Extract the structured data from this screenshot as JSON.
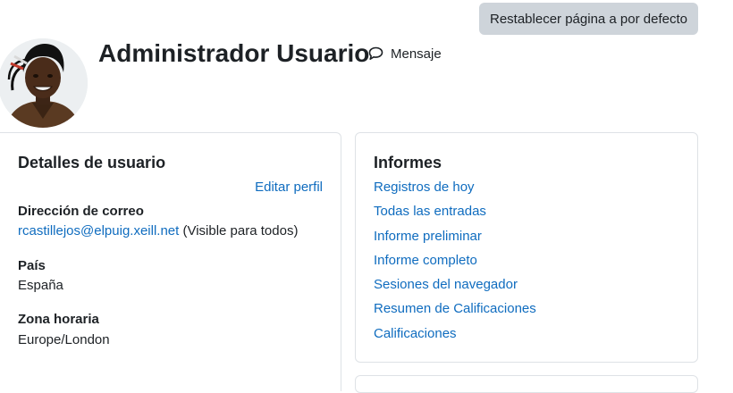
{
  "header": {
    "reset_button_label": "Restablecer página a por defecto",
    "user_name": "Administrador Usuario",
    "message_label": "Mensaje",
    "message_icon": "speech-bubble-icon",
    "avatar_icon": "user-avatar-photo"
  },
  "user_details": {
    "title": "Detalles de usuario",
    "edit_profile_label": "Editar perfil",
    "email": {
      "label": "Dirección de correo",
      "value": "rcastillejos@elpuig.xeill.net",
      "visibility": " (Visible para todos)"
    },
    "country": {
      "label": "País",
      "value": "España"
    },
    "timezone": {
      "label": "Zona horaria",
      "value": "Europe/London"
    }
  },
  "reports": {
    "title": "Informes",
    "links": [
      "Registros de hoy",
      "Todas las entradas",
      "Informe preliminar",
      "Informe completo",
      "Sesiones del navegador",
      "Resumen de Calificaciones",
      "Calificaciones"
    ]
  },
  "colors": {
    "link": "#0f6cbf",
    "text": "#1d2125",
    "button_bg": "#ced4da",
    "border": "#dee2e6"
  }
}
